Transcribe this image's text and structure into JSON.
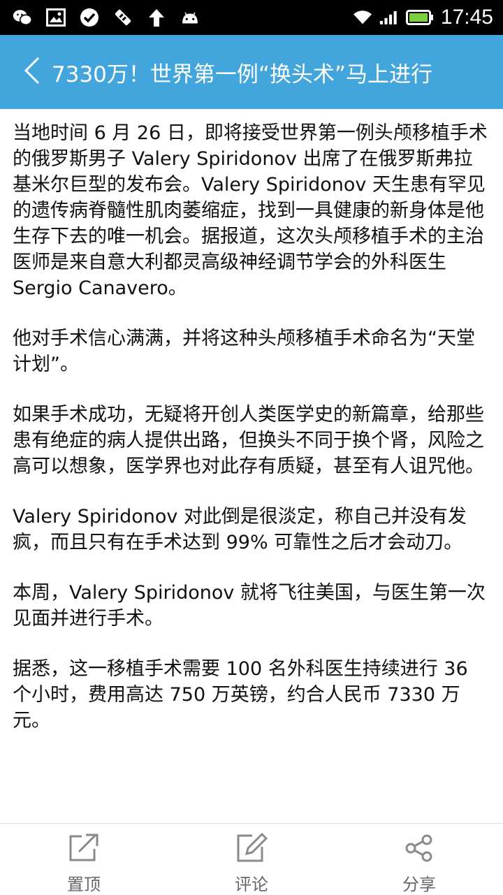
{
  "status_bar": {
    "time": "17:45",
    "icons": [
      "wechat-icon",
      "image-icon",
      "check-circle-icon",
      "tool-icon",
      "upload-arrow-icon",
      "android-icon",
      "wifi-icon",
      "signal-icon",
      "battery-icon"
    ]
  },
  "header": {
    "title": "7330万！世界第一例“换头术”马上进行",
    "back_icon": "chevron-left-icon",
    "background": "#42a5dc"
  },
  "article": {
    "paragraphs": [
      "当地时间 6 月 26 日，即将接受世界第一例头颅移植手术的俄罗斯男子 Valery Spiridonov 出席了在俄罗斯弗拉基米尔巨型的发布会。Valery Spiridonov 天生患有罕见的遗传病脊髓性肌肉萎缩症，找到一具健康的新身体是他生存下去的唯一机会。据报道，这次头颅移植手术的主治医师是来自意大利都灵高级神经调节学会的外科医生 Sergio Canavero。",
      "他对手术信心满满，并将这种头颅移植手术命名为“天堂计划”。",
      "如果手术成功，无疑将开创人类医学史的新篇章，给那些患有绝症的病人提供出路，但换头不同于换个肾，风险之高可以想象，医学界也对此存有质疑，甚至有人诅咒他。",
      "Valery Spiridonov 对此倒是很淡定，称自己并没有发疯，而且只有在手术达到 99% 可靠性之后才会动刀。",
      "本周，Valery Spiridonov 就将飞往美国，与医生第一次见面并进行手术。",
      "据悉，这一移植手术需要 100 名外科医生持续进行 36 个小时，费用高达 750 万英镑，约合人民币 7330 万元。"
    ]
  },
  "bottom_bar": {
    "tabs": [
      {
        "label": "置顶",
        "icon": "pin-top-icon"
      },
      {
        "label": "评论",
        "icon": "comment-edit-icon"
      },
      {
        "label": "分享",
        "icon": "share-icon"
      }
    ]
  }
}
